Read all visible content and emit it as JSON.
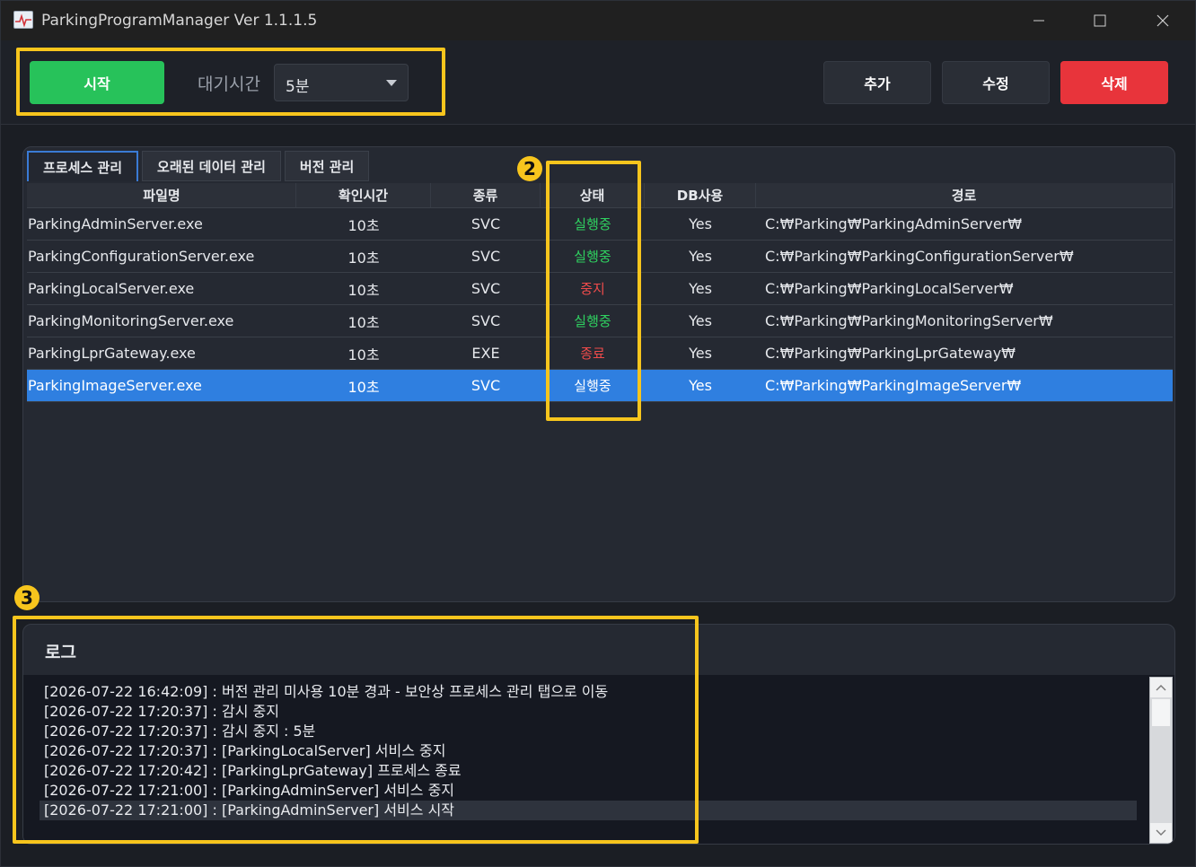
{
  "window": {
    "title": "ParkingProgramManager Ver 1.1.1.5"
  },
  "toolbar": {
    "start_label": "시작",
    "wait_label": "대기시간",
    "wait_value": "5분",
    "add_label": "추가",
    "edit_label": "수정",
    "delete_label": "삭제"
  },
  "tabs": [
    {
      "label": "프로세스 관리",
      "active": true
    },
    {
      "label": "오래된 데이터 관리",
      "active": false
    },
    {
      "label": "버전 관리",
      "active": false
    }
  ],
  "grid": {
    "columns": [
      "파일명",
      "확인시간",
      "종류",
      "상태",
      "DB사용",
      "경로"
    ],
    "rows": [
      {
        "file": "ParkingAdminServer.exe",
        "time": "10초",
        "type": "SVC",
        "status": "실행중",
        "db": "Yes",
        "path": "C:₩Parking₩ParkingAdminServer₩"
      },
      {
        "file": "ParkingConfigurationServer.exe",
        "time": "10초",
        "type": "SVC",
        "status": "실행중",
        "db": "Yes",
        "path": "C:₩Parking₩ParkingConfigurationServer₩"
      },
      {
        "file": "ParkingLocalServer.exe",
        "time": "10초",
        "type": "SVC",
        "status": "중지",
        "db": "Yes",
        "path": "C:₩Parking₩ParkingLocalServer₩"
      },
      {
        "file": "ParkingMonitoringServer.exe",
        "time": "10초",
        "type": "SVC",
        "status": "실행중",
        "db": "Yes",
        "path": "C:₩Parking₩ParkingMonitoringServer₩"
      },
      {
        "file": "ParkingLprGateway.exe",
        "time": "10초",
        "type": "EXE",
        "status": "종료",
        "db": "Yes",
        "path": "C:₩Parking₩ParkingLprGateway₩"
      },
      {
        "file": "ParkingImageServer.exe",
        "time": "10초",
        "type": "SVC",
        "status": "실행중",
        "db": "Yes",
        "path": "C:₩Parking₩ParkingImageServer₩"
      }
    ]
  },
  "log": {
    "title": "로그",
    "lines": [
      "[2026-07-22 16:42:09] : 버전 관리 미사용 10분 경과 - 보안상 프로세스 관리 탭으로 이동",
      "[2026-07-22 17:20:37] : 감시 중지",
      "[2026-07-22 17:20:37] : 감시 중지 : 5분",
      "[2026-07-22 17:20:37] : [ParkingLocalServer] 서비스 중지",
      "[2026-07-22 17:20:42] : [ParkingLprGateway] 프로세스 종료",
      "[2026-07-22 17:21:00] : [ParkingAdminServer] 서비스 중지",
      "[2026-07-22 17:21:00] : [ParkingAdminServer] 서비스 시작"
    ]
  },
  "annotations": {
    "marker_2": "2",
    "marker_3": "3"
  },
  "colors": {
    "start": "#27c25a",
    "delete": "#e8343b",
    "running": "#2fd160",
    "stopped": "#ef4b4b",
    "selected_row": "#2f7fe0",
    "highlight": "#f7c51d"
  }
}
